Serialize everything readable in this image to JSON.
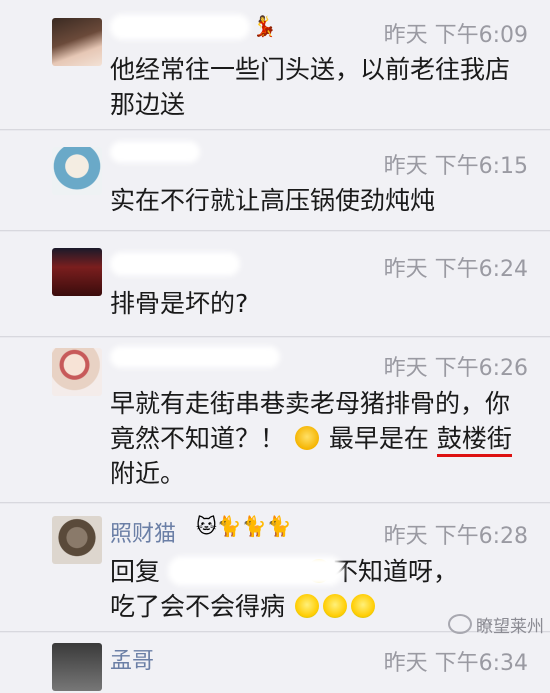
{
  "messages": [
    {
      "time": "昨天 下午6:09",
      "text": "他经常往一些门头送，以前老往我店那边送"
    },
    {
      "time": "昨天 下午6:15",
      "text": "实在不行就让高压锅使劲炖炖"
    },
    {
      "time": "昨天 下午6:24",
      "text": "排骨是坏的?"
    },
    {
      "time": "昨天 下午6:26",
      "text_a": "早就有走街串巷卖老母猪排骨的，你竟然不知道？！",
      "text_b": "最早是在",
      "text_underlined": "鼓楼街",
      "text_c": "附近。"
    },
    {
      "name": "照财猫",
      "name_emoji": "🐱🐈🐈🐈",
      "time": "昨天 下午6:28",
      "text_a": "回复",
      "text_b": "不知道呀，",
      "text_c": "吃了会不会得病"
    },
    {
      "name": "孟哥",
      "time": "昨天 下午6:34"
    }
  ],
  "watermark": "瞭望莱州"
}
